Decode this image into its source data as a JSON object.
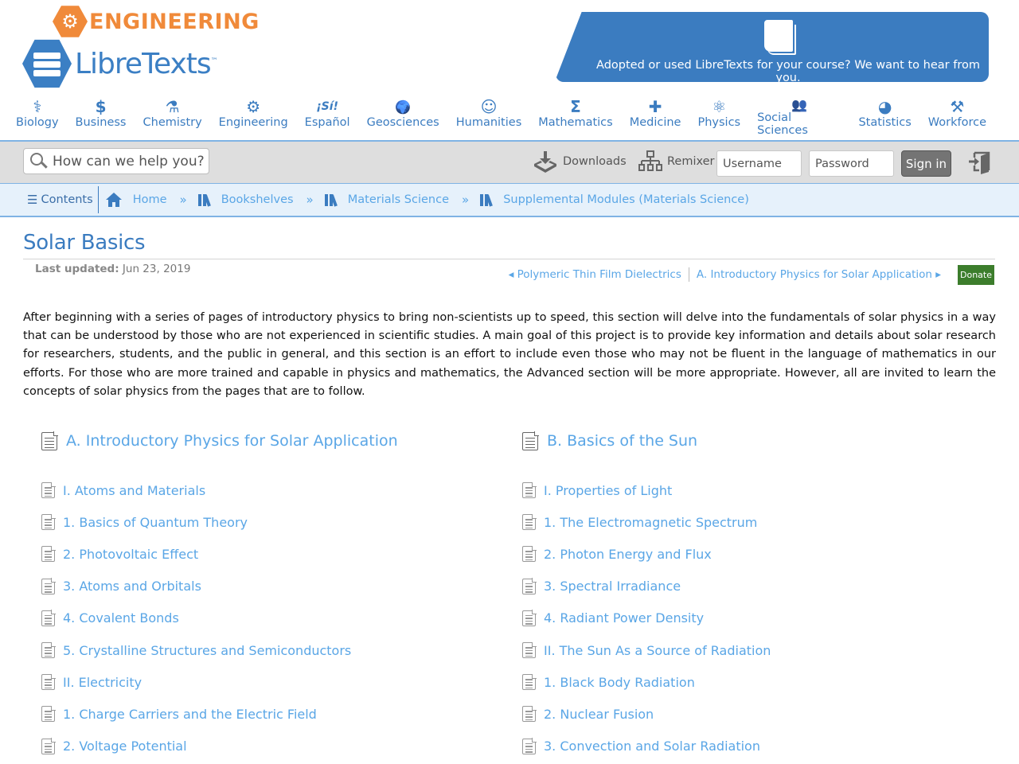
{
  "brand": {
    "library": "ENGINEERING",
    "name": "LibreTexts",
    "trademark": "™",
    "accent_color": "#3b7cc0",
    "library_color": "#f08a3a"
  },
  "adopt_banner": {
    "icon": "book-icon",
    "text": "Adopted or used LibreTexts for your course? We want to hear from you."
  },
  "subjects": [
    {
      "label": "Biology",
      "icon": "dna-icon",
      "glyph": "⚕"
    },
    {
      "label": "Business",
      "icon": "dollar-icon",
      "glyph": "$"
    },
    {
      "label": "Chemistry",
      "icon": "flask-icon",
      "glyph": "⚗"
    },
    {
      "label": "Engineering",
      "icon": "gear-wrench-icon",
      "glyph": "⚙"
    },
    {
      "label": "Español",
      "icon": "si-icon",
      "glyph": "¡Sí!"
    },
    {
      "label": "Geosciences",
      "icon": "globe-icon",
      "glyph": "🌍"
    },
    {
      "label": "Humanities",
      "icon": "head-icon",
      "glyph": "☺"
    },
    {
      "label": "Mathematics",
      "icon": "sigma-icon",
      "glyph": "Σ"
    },
    {
      "label": "Medicine",
      "icon": "plus-icon",
      "glyph": "✚"
    },
    {
      "label": "Physics",
      "icon": "atom-icon",
      "glyph": "⚛"
    },
    {
      "label": "Social Sciences",
      "icon": "people-icon",
      "glyph": "👥"
    },
    {
      "label": "Statistics",
      "icon": "pie-chart-icon",
      "glyph": "◕"
    },
    {
      "label": "Workforce",
      "icon": "tools-icon",
      "glyph": "⚒"
    }
  ],
  "toolbar": {
    "search_placeholder": "How can we help you?",
    "downloads_label": "Downloads",
    "remixer_label": "Remixer",
    "username_placeholder": "Username",
    "password_placeholder": "Password",
    "signin_label": "Sign in"
  },
  "breadcrumb": {
    "contents_label": "Contents",
    "separator": "»",
    "items": [
      {
        "label": "Home",
        "icon": "home-icon"
      },
      {
        "label": "Bookshelves",
        "icon": "bookshelf-icon"
      },
      {
        "label": "Materials Science",
        "icon": "bookshelf-icon"
      },
      {
        "label": "Supplemental Modules (Materials Science)",
        "icon": "bookshelf-icon"
      }
    ]
  },
  "page": {
    "title": "Solar Basics",
    "last_updated_label": "Last updated:",
    "last_updated_value": "Jun 23, 2019",
    "prev_label": "◂ Polymeric Thin Film Dielectrics",
    "next_label": "A. Introductory Physics for Solar Application ▸",
    "donate_label": "Donate",
    "donate_color": "#3c7d2c",
    "intro": "After beginning with a series of pages of introductory physics to bring non-scientists up to speed, this section will delve into the fundamentals of solar physics in a way that can be understood by those who are not experienced in scientific studies. A main goal of this project is to provide key information and details about solar research for researchers, students, and the public in general, and this section is an effort to include even those who may not be fluent in the language of mathematics in our efforts. For those who are more trained and capable in physics and mathematics, the Advanced section will be more appropriate. However, all are invited to learn the concepts of solar physics from the pages that are to follow."
  },
  "sections": [
    {
      "title": "A. Introductory Physics for Solar Application",
      "items": [
        "I. Atoms and Materials",
        "1. Basics of Quantum Theory",
        "2. Photovoltaic Effect",
        "3. Atoms and Orbitals",
        "4. Covalent Bonds",
        "5. Crystalline Structures and Semiconductors",
        "II. Electricity",
        "1. Charge Carriers and the Electric Field",
        "2. Voltage Potential"
      ]
    },
    {
      "title": "B. Basics of the Sun",
      "items": [
        "I. Properties of Light",
        "1. The Electromagnetic Spectrum",
        "2. Photon Energy and Flux",
        "3. Spectral Irradiance",
        "4. Radiant Power Density",
        "II. The Sun As a Source of Radiation",
        "1. Black Body Radiation",
        "2. Nuclear Fusion",
        "3. Convection and Solar Radiation"
      ]
    }
  ]
}
